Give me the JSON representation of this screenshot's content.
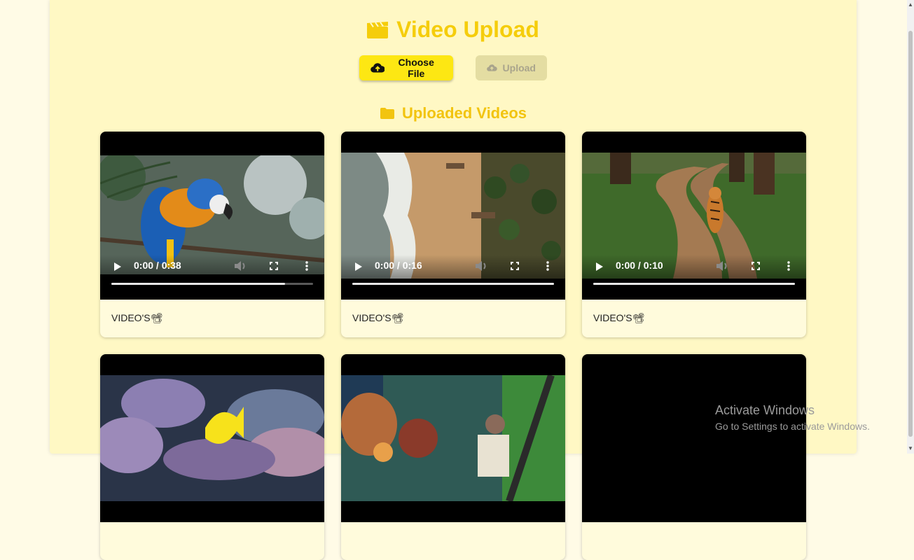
{
  "header": {
    "title": "Video Upload",
    "icon": "clapperboard-icon",
    "accent": "#f5cd0b"
  },
  "actions": {
    "choose_label": "Choose File",
    "upload_label": "Upload",
    "choose_color": "#fde713",
    "upload_disabled": true
  },
  "videos_section": {
    "title": "Uploaded Videos",
    "icon": "folder-icon"
  },
  "videos": [
    {
      "time": "0:00 / 0:38",
      "label": "VIDEO'S📽",
      "scene": "macaw on a branch",
      "progress": 0.86
    },
    {
      "time": "0:00 / 0:16",
      "label": "VIDEO'S📽",
      "scene": "aerial beach shoreline",
      "progress": 1.0
    },
    {
      "time": "0:00 / 0:10",
      "label": "VIDEO'S📽",
      "scene": "tiger on a forest road",
      "progress": 1.0
    },
    {
      "scene": "yellow tang fish in coral reef"
    },
    {
      "scene": "street food vendor by a train"
    },
    {
      "scene": "black (not loaded)"
    }
  ],
  "watermark": {
    "line1": "Activate Windows",
    "line2": "Go to Settings to activate Windows."
  }
}
